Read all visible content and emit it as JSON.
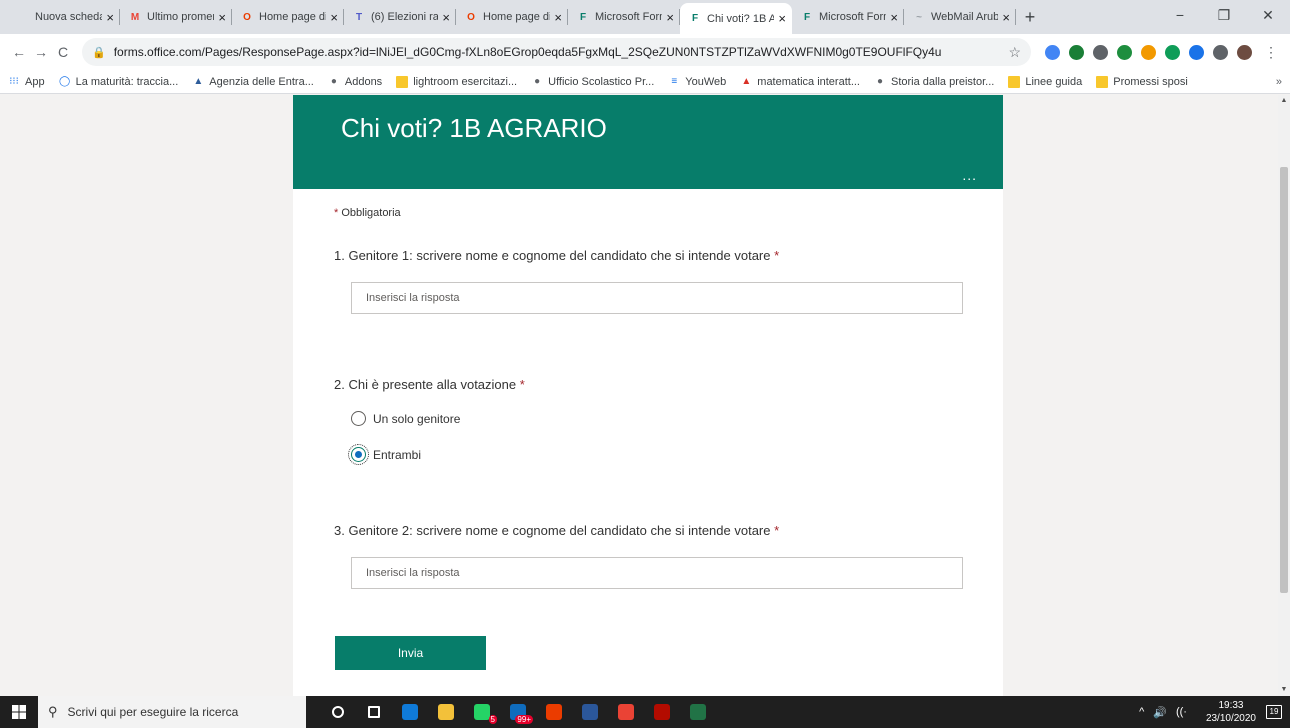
{
  "browser": {
    "tabs": [
      {
        "label": "Nuova scheda",
        "icon": "",
        "icon_color": "",
        "active": false
      },
      {
        "label": "Ultimo promem",
        "icon": "M",
        "icon_color": "#ea4335",
        "active": false
      },
      {
        "label": "Home page di",
        "icon": "O",
        "icon_color": "#eb3c00",
        "active": false
      },
      {
        "label": "(6) Elezioni rap",
        "icon": "T",
        "icon_color": "#5059c9",
        "active": false
      },
      {
        "label": "Home page di",
        "icon": "O",
        "icon_color": "#eb3c00",
        "active": false
      },
      {
        "label": "Microsoft Form",
        "icon": "F",
        "icon_color": "#077d6a",
        "active": false
      },
      {
        "label": "Chi voti? 1B AC",
        "icon": "F",
        "icon_color": "#077d6a",
        "active": true
      },
      {
        "label": "Microsoft Form",
        "icon": "F",
        "icon_color": "#077d6a",
        "active": false
      },
      {
        "label": "WebMail Arub",
        "icon": "~",
        "icon_color": "#9aa0a6",
        "active": false
      }
    ],
    "close_glyph": "×",
    "new_tab_glyph": "+",
    "window_controls": {
      "minimize": "−",
      "restore": "❐",
      "close": "✕"
    },
    "nav": {
      "back": "←",
      "forward": "→",
      "reload": "C"
    },
    "url": "forms.office.com/Pages/ResponsePage.aspx?id=lNiJEl_dG0Cmg-fXLn8oEGrop0eqda5FgxMqL_2SQeZUN0NTSTZPTlZaWVdXWFNIM0g0TE9OUFlFQy4u",
    "lock_icon": "🔒",
    "star_icon": "☆",
    "menu_icon": "⋮",
    "extension_colors": [
      "#4285f4",
      "#1a7f37",
      "#5f6368",
      "#1e8e3e",
      "#f29900",
      "#0f9d58",
      "#1a73e8",
      "#5f6368",
      "#6d4c41"
    ],
    "bookmarks": [
      {
        "label": "App",
        "icon": "apps-icon",
        "glyph": "⁝⁝⁝",
        "color": "#1a73e8",
        "folder": false
      },
      {
        "label": "La maturità: traccia...",
        "icon": "circle-icon",
        "glyph": "◯",
        "color": "#1a73e8",
        "folder": false
      },
      {
        "label": "Agenzia delle Entra...",
        "icon": "agency-icon",
        "glyph": "▲",
        "color": "#2e5c9a",
        "folder": false
      },
      {
        "label": "Addons",
        "icon": "globe-icon",
        "glyph": "●",
        "color": "#5f6368",
        "folder": false
      },
      {
        "label": "lightroom esercitazi...",
        "icon": "folder-icon",
        "glyph": "",
        "color": "#f8c72c",
        "folder": true
      },
      {
        "label": "Ufficio Scolastico Pr...",
        "icon": "globe-icon",
        "glyph": "●",
        "color": "#5f6368",
        "folder": false
      },
      {
        "label": "YouWeb",
        "icon": "youweb-icon",
        "glyph": "≡",
        "color": "#1a73e8",
        "folder": false
      },
      {
        "label": "matematica interatt...",
        "icon": "acrobat-icon",
        "glyph": "▲",
        "color": "#d93025",
        "folder": false
      },
      {
        "label": "Storia dalla preistor...",
        "icon": "globe-icon",
        "glyph": "●",
        "color": "#5f6368",
        "folder": false
      },
      {
        "label": "Linee guida",
        "icon": "folder-icon",
        "glyph": "",
        "color": "#f8c72c",
        "folder": true
      },
      {
        "label": "Promessi sposi",
        "icon": "folder-icon",
        "glyph": "",
        "color": "#f8c72c",
        "folder": true
      }
    ],
    "bookmarks_more": "»"
  },
  "form": {
    "title": "Chi voti? 1B AGRARIO",
    "more_glyph": "...",
    "required_note": "Obbligatoria",
    "required_star": "*",
    "questions": [
      {
        "label": "1. Genitore 1: scrivere nome e cognome del candidato che si intende votare",
        "placeholder": "Inserisci la risposta"
      },
      {
        "label": "2. Chi è presente alla votazione",
        "options": [
          {
            "label": "Un solo genitore",
            "selected": false
          },
          {
            "label": "Entrambi",
            "selected": true
          }
        ]
      },
      {
        "label": "3. Genitore 2: scrivere nome e cognome del candidato che si intende votare",
        "placeholder": "Inserisci la risposta"
      }
    ],
    "submit_label": "Invia",
    "accent_color": "#077d6a"
  },
  "taskbar": {
    "search_placeholder": "Scrivi qui per eseguire la ricerca",
    "apps": [
      {
        "name": "cortana-icon",
        "color": "",
        "badge": ""
      },
      {
        "name": "task-view-icon",
        "color": "",
        "badge": ""
      },
      {
        "name": "edge-icon",
        "color": "#0f7ad8",
        "badge": ""
      },
      {
        "name": "file-explorer-icon",
        "color": "#f3c13a",
        "badge": ""
      },
      {
        "name": "whatsapp-icon",
        "color": "#25d366",
        "badge": "5"
      },
      {
        "name": "mail-icon",
        "color": "#0f6cbd",
        "badge": "99+"
      },
      {
        "name": "office-icon",
        "color": "#eb3c00",
        "badge": ""
      },
      {
        "name": "word-icon",
        "color": "#2b579a",
        "badge": ""
      },
      {
        "name": "chrome-icon",
        "color": "#ea4335",
        "badge": ""
      },
      {
        "name": "acrobat-icon",
        "color": "#b30b00",
        "badge": ""
      },
      {
        "name": "excel-icon",
        "color": "#217346",
        "badge": ""
      }
    ],
    "tray_chevron": "^",
    "tray_volume": "🔊",
    "tray_network": "((·",
    "time": "19:33",
    "date": "23/10/2020",
    "notifications": "19"
  }
}
